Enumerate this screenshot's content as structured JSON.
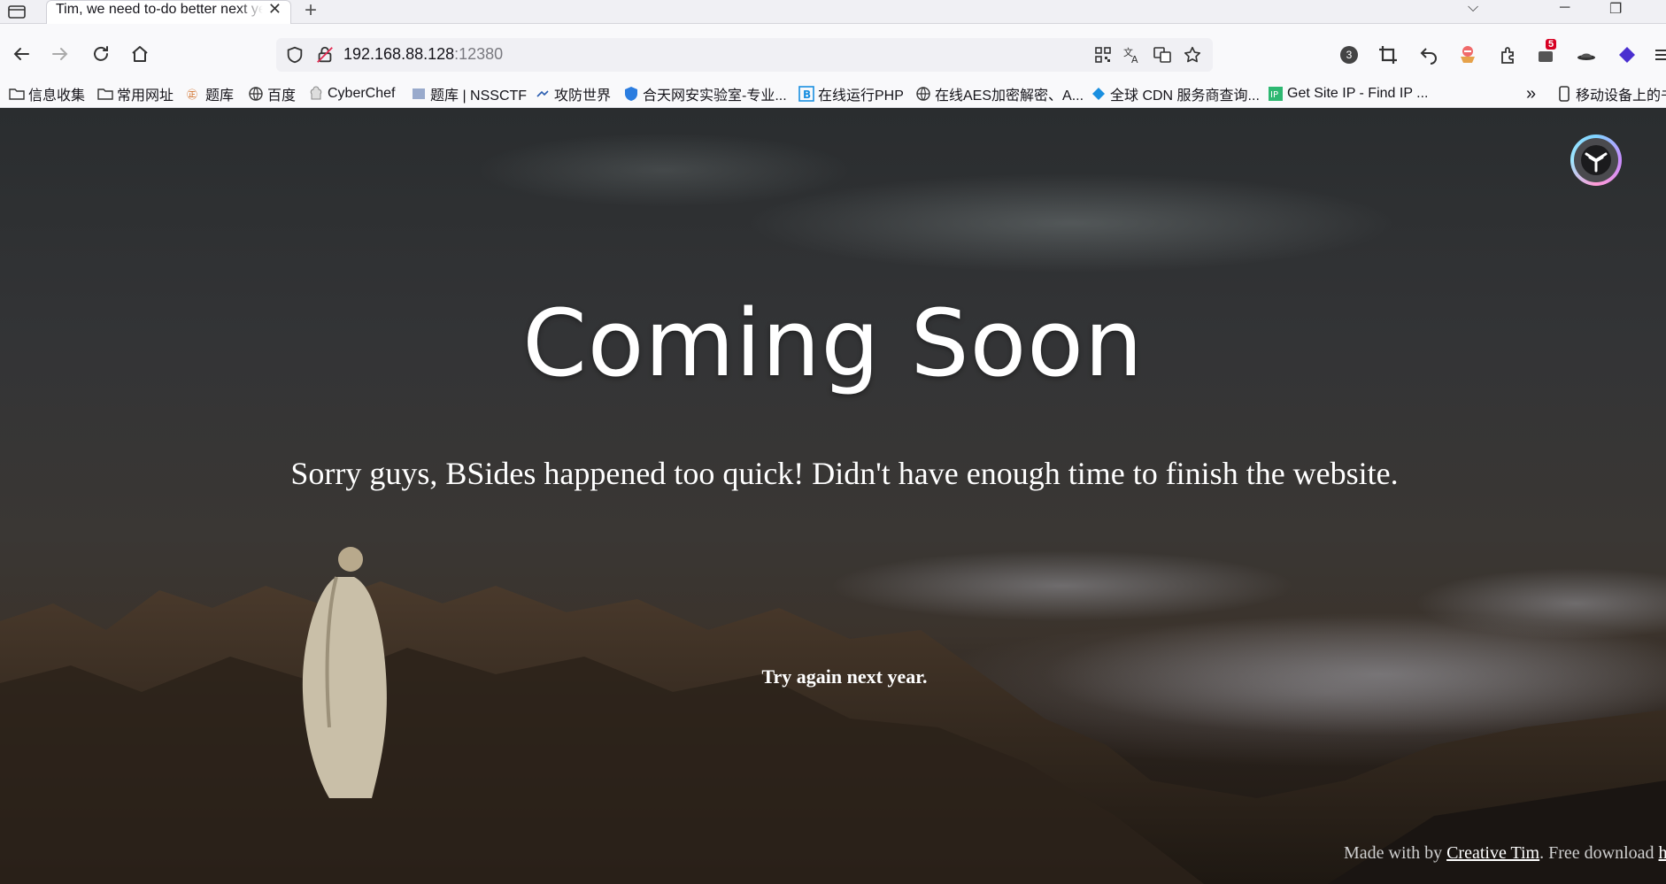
{
  "browser": {
    "tab_title": "Tim, we need to-do better next year",
    "tab_close": "✕",
    "new_tab": "+",
    "url_host": "192.168.88.128",
    "url_port": ":12380",
    "window_controls": [
      "⌵",
      "─",
      "❐"
    ]
  },
  "extensions": {
    "badge_count": "3",
    "notification_count": "5"
  },
  "bookmarks": [
    {
      "label": "信息收集",
      "icon": "folder-icon"
    },
    {
      "label": "常用网址",
      "icon": "folder-icon"
    },
    {
      "label": "题库",
      "icon": "site-icon"
    },
    {
      "label": "百度",
      "icon": "globe-icon"
    },
    {
      "label": "CyberChef",
      "icon": "chef-icon"
    },
    {
      "label": "题库 | NSSCTF",
      "icon": "site-icon"
    },
    {
      "label": "攻防世界",
      "icon": "site-icon"
    },
    {
      "label": "合天网安实验室-专业...",
      "icon": "shield-icon"
    },
    {
      "label": "在线运行PHP",
      "icon": "b-icon"
    },
    {
      "label": "在线AES加密解密、A...",
      "icon": "globe-icon"
    },
    {
      "label": "全球 CDN 服务商查询...",
      "icon": "diamond-icon"
    },
    {
      "label": "Get Site IP - Find IP ...",
      "icon": "ip-icon"
    }
  ],
  "bookmarks_overflow": "»",
  "mobile_bookmarks": "移动设备上的书签",
  "page": {
    "heading": "Coming Soon",
    "subtitle": "Sorry guys, BSides happened too quick! Didn't have enough time to finish the website.",
    "note": "Try again next year.",
    "footer_prefix": "Made with by ",
    "footer_link": "Creative Tim",
    "footer_suffix": ". Free download ",
    "footer_link2": "h"
  },
  "colors": {
    "text": "#ffffff",
    "chrome_bg": "#f9f9fb",
    "tabbar_bg": "#f0f0f4"
  }
}
